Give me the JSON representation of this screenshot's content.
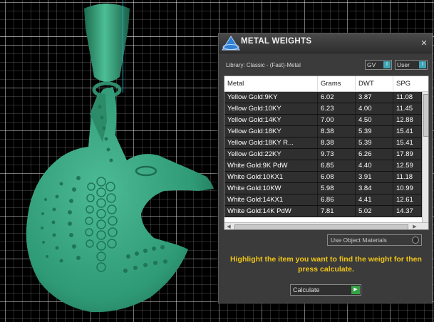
{
  "colors": {
    "model_green": "#3aa07e",
    "highlight": "#f0c419",
    "row_bg": "#2f2f2f",
    "toggle_accent": "#3ea5b4",
    "play_green": "#35a244"
  },
  "panel": {
    "title": "METAL WEIGHTS",
    "logo_icon": "app-logo-icon",
    "close_icon": "close-icon",
    "close_symbol": "✕",
    "library_label": "Library: Classic - (Fast)-Metal",
    "toggles": {
      "gv": {
        "label": "GV",
        "box": "I"
      },
      "user": {
        "label": "User",
        "box": "I"
      }
    }
  },
  "table": {
    "columns": [
      "Metal",
      "Grams",
      "DWT",
      "SPG"
    ],
    "rows": [
      {
        "metal": "Yellow Gold:9KY",
        "grams": "6.02",
        "dwt": "3.87",
        "spg": "11.08"
      },
      {
        "metal": "Yellow Gold:10KY",
        "grams": "6.23",
        "dwt": "4.00",
        "spg": "11.45"
      },
      {
        "metal": "Yellow Gold:14KY",
        "grams": "7.00",
        "dwt": "4.50",
        "spg": "12.88"
      },
      {
        "metal": "Yellow Gold:18KY",
        "grams": "8.38",
        "dwt": "5.39",
        "spg": "15.41"
      },
      {
        "metal": "Yellow Gold:18KY R...",
        "grams": "8.38",
        "dwt": "5.39",
        "spg": "15.41"
      },
      {
        "metal": "Yellow Gold:22KY",
        "grams": "9.73",
        "dwt": "6.26",
        "spg": "17.89"
      },
      {
        "metal": "White Gold:9K PdW",
        "grams": "6.85",
        "dwt": "4.40",
        "spg": "12.59"
      },
      {
        "metal": "White Gold:10KX1",
        "grams": "6.08",
        "dwt": "3.91",
        "spg": "11.18"
      },
      {
        "metal": "White Gold:10KW",
        "grams": "5.98",
        "dwt": "3.84",
        "spg": "10.99"
      },
      {
        "metal": "White Gold:14KX1",
        "grams": "6.86",
        "dwt": "4.41",
        "spg": "12.61"
      },
      {
        "metal": "White Gold:14K PdW",
        "grams": "7.81",
        "dwt": "5.02",
        "spg": "14.37"
      }
    ]
  },
  "use_object_materials": {
    "label": "Use Object Materials",
    "checked": false
  },
  "instructions": "Highlight the item you want to find the weight for then press calculate.",
  "calculate": {
    "label": "Calculate",
    "icon": "play-icon",
    "symbol": "▶"
  }
}
